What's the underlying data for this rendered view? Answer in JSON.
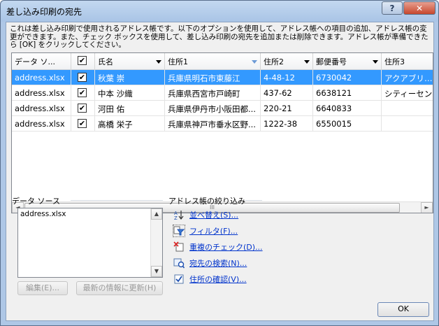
{
  "window": {
    "title": "差し込み印刷の宛先",
    "help_label": "?",
    "close_label": "✕"
  },
  "description": "これは差し込み印刷で使用されるアドレス帳です。以下のオプションを使用して、アドレス帳への項目の追加、アドレス帳の変更ができます。また、チェック ボックスを使用して、差し込み印刷の宛先を追加または削除できます。アドレス帳が準備できたら [OK] をクリックしてください。",
  "grid": {
    "headers": [
      "データ ソ...",
      "",
      "氏名",
      "住所1",
      "住所2",
      "郵便番号",
      "住所3"
    ],
    "rows": [
      {
        "source": "address.xlsx",
        "checked": "✔",
        "name": "秋葉 崇",
        "addr1": "兵庫県明石市東藤江",
        "addr2": "4-48-12",
        "zip": "6730042",
        "addr3": "アクアブリッジ",
        "selected": true
      },
      {
        "source": "address.xlsx",
        "checked": "✔",
        "name": "中本 沙織",
        "addr1": "兵庫県西宮市戸崎町",
        "addr2": "437-62",
        "zip": "6638121",
        "addr3": "シティーセン",
        "selected": false
      },
      {
        "source": "address.xlsx",
        "checked": "✔",
        "name": "河田 佑",
        "addr1": "兵庫県伊丹市小阪田都...",
        "addr2": "220-21",
        "zip": "6640833",
        "addr3": "",
        "selected": false
      },
      {
        "source": "address.xlsx",
        "checked": "✔",
        "name": "高橋 栄子",
        "addr1": "兵庫県神戸市垂水区野...",
        "addr2": "1222-38",
        "zip": "6550015",
        "addr3": "",
        "selected": false
      }
    ],
    "header_check": "✔",
    "scroll_left": "◄",
    "scroll_right": "►",
    "thumb_grip": "III"
  },
  "datasource": {
    "label": "データ ソース",
    "items": [
      "address.xlsx"
    ],
    "scroll_up": "▲",
    "scroll_down": "▼",
    "edit_label": "編集(E)...",
    "refresh_label": "最新の情報に更新(H)"
  },
  "refine": {
    "label": "アドレス帳の絞り込み",
    "sort": "並べ替え(S)...",
    "filter": "フィルタ(F)...",
    "duplicates": "重複のチェック(D)...",
    "find": "宛先の検索(N)...",
    "validate": "住所の確認(V)..."
  },
  "ok_label": "OK"
}
